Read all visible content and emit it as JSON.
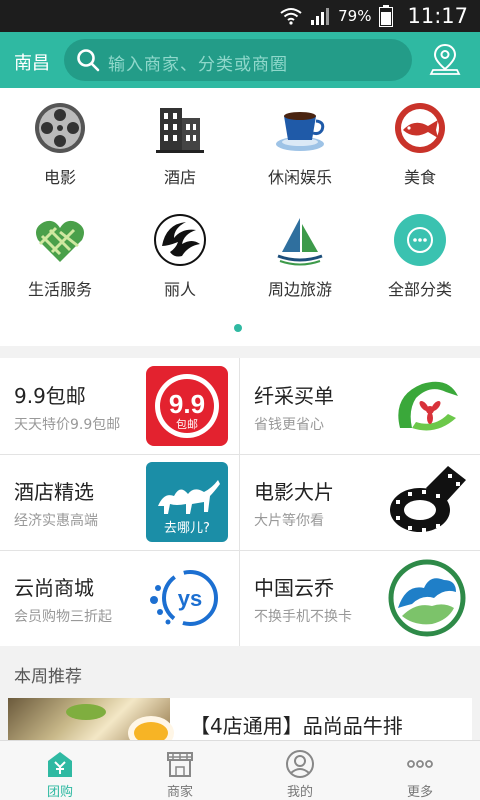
{
  "status_bar": {
    "battery_percent": "79%",
    "time": "11:17"
  },
  "header": {
    "city": "南昌",
    "search_placeholder": "输入商家、分类或商圈"
  },
  "categories": [
    {
      "label": "电影",
      "icon": "film-reel-icon"
    },
    {
      "label": "酒店",
      "icon": "hotel-building-icon"
    },
    {
      "label": "休闲娱乐",
      "icon": "coffee-cup-icon"
    },
    {
      "label": "美食",
      "icon": "fish-plate-icon"
    },
    {
      "label": "生活服务",
      "icon": "heart-ribbon-icon"
    },
    {
      "label": "丽人",
      "icon": "phoenix-icon"
    },
    {
      "label": "周边旅游",
      "icon": "sailboat-icon"
    },
    {
      "label": "全部分类",
      "icon": "more-dots-icon"
    }
  ],
  "page_indicator": {
    "count": 1,
    "active": 1
  },
  "promos": [
    {
      "title": "9.9包邮",
      "subtitle": "天天特价9.9包邮",
      "image_text_big": "9.9",
      "image_text_small": "包邮"
    },
    {
      "title": "纤采买单",
      "subtitle": "省钱更省心"
    },
    {
      "title": "酒店精选",
      "subtitle": "经济实惠高端",
      "image_text": "去哪儿?"
    },
    {
      "title": "电影大片",
      "subtitle": "大片等你看"
    },
    {
      "title": "云尚商城",
      "subtitle": "会员购物三折起",
      "image_text": "ys"
    },
    {
      "title": "中国云乔",
      "subtitle": "不换手机不换卡"
    }
  ],
  "weekly": {
    "section_title": "本周推荐",
    "deal_title": "【4店通用】品尚品牛排"
  },
  "bottom_nav": [
    {
      "label": "团购",
      "icon": "tuangou-icon",
      "active": true
    },
    {
      "label": "商家",
      "icon": "shop-icon",
      "active": false
    },
    {
      "label": "我的",
      "icon": "profile-icon",
      "active": false
    },
    {
      "label": "更多",
      "icon": "more-icon",
      "active": false
    }
  ],
  "colors": {
    "accent": "#2fb9a2",
    "search_bg": "#239c88",
    "status_bar": "#1d1d1d"
  }
}
